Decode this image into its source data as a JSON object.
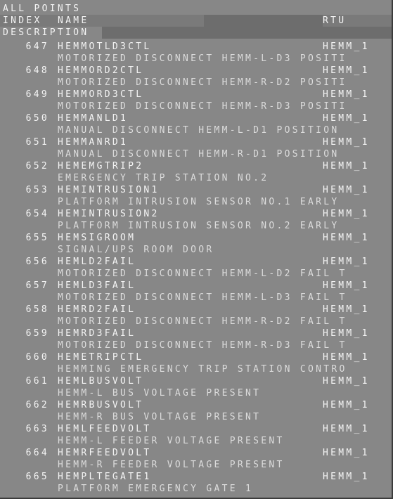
{
  "title": "ALL POINTS",
  "header": {
    "index": "INDEX",
    "name": "NAME",
    "rtu": "RTU",
    "description": "DESCRIPTION"
  },
  "records": [
    {
      "index": "647",
      "name": "HEMMOTLD3CTL",
      "rtu": "HEMM_1",
      "description": "MOTORIZED DISCONNECT HEMM-L-D3 POSITI"
    },
    {
      "index": "648",
      "name": "HEMMORD2CTL",
      "rtu": "HEMM_1",
      "description": "MOTORIZED DISCONNECT HEMM-R-D2 POSITI"
    },
    {
      "index": "649",
      "name": "HEMMORD3CTL",
      "rtu": "HEMM_1",
      "description": "MOTORIZED DISCONNECT HEMM-R-D3 POSITI"
    },
    {
      "index": "650",
      "name": "HEMMANLD1",
      "rtu": "HEMM_1",
      "description": "MANUAL DISCONNECT HEMM-L-D1 POSITION"
    },
    {
      "index": "651",
      "name": "HEMMANRD1",
      "rtu": "HEMM_1",
      "description": "MANUAL DISCONNECT HEMM-R-D1 POSITION"
    },
    {
      "index": "652",
      "name": "HEMEMGTRIP2",
      "rtu": "HEMM_1",
      "description": "EMERGENCY TRIP STATION NO.2"
    },
    {
      "index": "653",
      "name": "HEMINTRUSION1",
      "rtu": "HEMM_1",
      "description": "PLATFORM INTRUSION SENSOR NO.1 EARLY"
    },
    {
      "index": "654",
      "name": "HEMINTRUSION2",
      "rtu": "HEMM_1",
      "description": "PLATFORM INTRUSION SENSOR NO.2 EARLY"
    },
    {
      "index": "655",
      "name": "HEMSIGROOM",
      "rtu": "HEMM_1",
      "description": "SIGNAL/UPS ROOM DOOR"
    },
    {
      "index": "656",
      "name": "HEMLD2FAIL",
      "rtu": "HEMM_1",
      "description": "MOTORIZED DISCONNECT HEMM-L-D2 FAIL T"
    },
    {
      "index": "657",
      "name": "HEMLD3FAIL",
      "rtu": "HEMM_1",
      "description": "MOTORIZED DISCONNECT HEMM-L-D3 FAIL T"
    },
    {
      "index": "658",
      "name": "HEMRD2FAIL",
      "rtu": "HEMM_1",
      "description": "MOTORIZED DISCONNECT HEMM-R-D2 FAIL T"
    },
    {
      "index": "659",
      "name": "HEMRD3FAIL",
      "rtu": "HEMM_1",
      "description": "MOTORIZED DISCONNECT HEMM-R-D3 FAIL T"
    },
    {
      "index": "660",
      "name": "HEMETRIPCTL",
      "rtu": "HEMM_1",
      "description": "HEMMING EMERGENCY TRIP STATION CONTRO"
    },
    {
      "index": "661",
      "name": "HEMLBUSVOLT",
      "rtu": "HEMM_1",
      "description": "HEMM-L BUS VOLTAGE PRESENT"
    },
    {
      "index": "662",
      "name": "HEMRBUSVOLT",
      "rtu": "HEMM_1",
      "description": "HEMM-R BUS VOLTAGE PRESENT"
    },
    {
      "index": "663",
      "name": "HEMLFEEDVOLT",
      "rtu": "HEMM_1",
      "description": "HEMM-L FEEDER VOLTAGE PRESENT"
    },
    {
      "index": "664",
      "name": "HEMRFEEDVOLT",
      "rtu": "HEMM_1",
      "description": "HEMM-R FEEDER VOLTAGE PRESENT"
    },
    {
      "index": "665",
      "name": "HEMPLTEGATE1",
      "rtu": "HEMM_1",
      "description": "PLATFORM EMERGENCY GATE 1"
    }
  ]
}
